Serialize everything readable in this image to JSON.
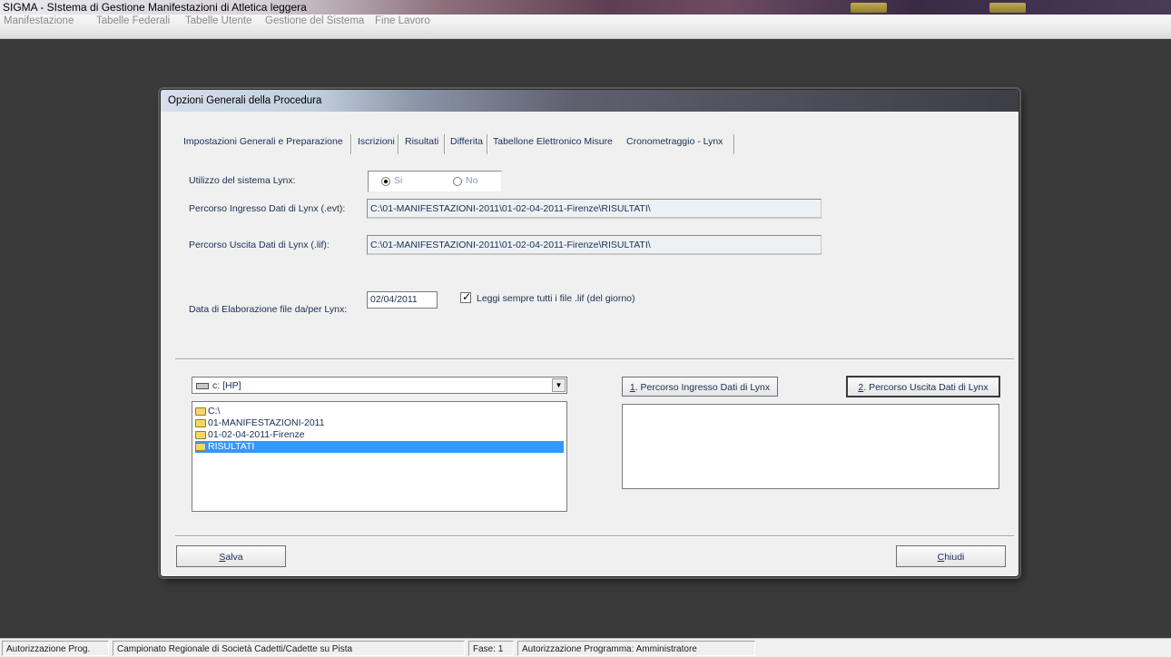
{
  "window": {
    "title": "SIGMA - SIstema di Gestione Manifestazioni di Atletica leggera"
  },
  "menu": {
    "items": [
      "Manifestazione",
      "Tabelle Federali",
      "Tabelle Utente",
      "Gestione del Sistema",
      "Fine Lavoro"
    ]
  },
  "dialog": {
    "title": "Opzioni Generali della Procedura",
    "tabs": [
      "Impostazioni Generali e Preparazione",
      "Iscrizioni",
      "Risultati",
      "Differita",
      "Tabellone Elettronico Misure",
      "Cronometraggio - Lynx"
    ],
    "active_tab": "Cronometraggio - Lynx",
    "lynx_usage": {
      "label": "Utilizzo del sistema Lynx:",
      "options": [
        "Si",
        "No"
      ],
      "selected": "Si"
    },
    "input_path": {
      "label": "Percorso Ingresso Dati di Lynx (.evt):",
      "value": "C:\\01-MANIFESTAZIONI-2011\\01-02-04-2011-Firenze\\RISULTATI\\"
    },
    "output_path": {
      "label": "Percorso Uscita Dati di Lynx (.lif):",
      "value": "C:\\01-MANIFESTAZIONI-2011\\01-02-04-2011-Firenze\\RISULTATI\\"
    },
    "processing_date": {
      "label": "Data di Elaborazione file da/per Lynx:",
      "value": "02/04/2011"
    },
    "read_all_lif": {
      "label": "Leggi sempre tutti i file .lif (del giorno)",
      "checked": true
    },
    "drive": {
      "value": "c: [HP]"
    },
    "directory_tree": [
      {
        "label": "C:\\",
        "indent": 0,
        "selected": false
      },
      {
        "label": "01-MANIFESTAZIONI-2011",
        "indent": 0,
        "selected": false
      },
      {
        "label": "01-02-04-2011-Firenze",
        "indent": 0,
        "selected": false
      },
      {
        "label": "RISULTATI",
        "indent": 0,
        "selected": true
      }
    ],
    "btn_input_path": {
      "accel": "1",
      "label": ". Percorso Ingresso Dati di Lynx"
    },
    "btn_output_path": {
      "accel": "2",
      "label": ". Percorso Uscita Dati di Lynx"
    },
    "btn_save": {
      "accel": "S",
      "label": "alva"
    },
    "btn_close": {
      "accel": "C",
      "label": "hiudi"
    }
  },
  "statusbar": {
    "cells": [
      "Autorizzazione Prog.",
      "Campionato Regionale di Società Cadetti/Cadette su Pista",
      "Fase: 1",
      "Autorizzazione Programma: Amministratore"
    ]
  }
}
